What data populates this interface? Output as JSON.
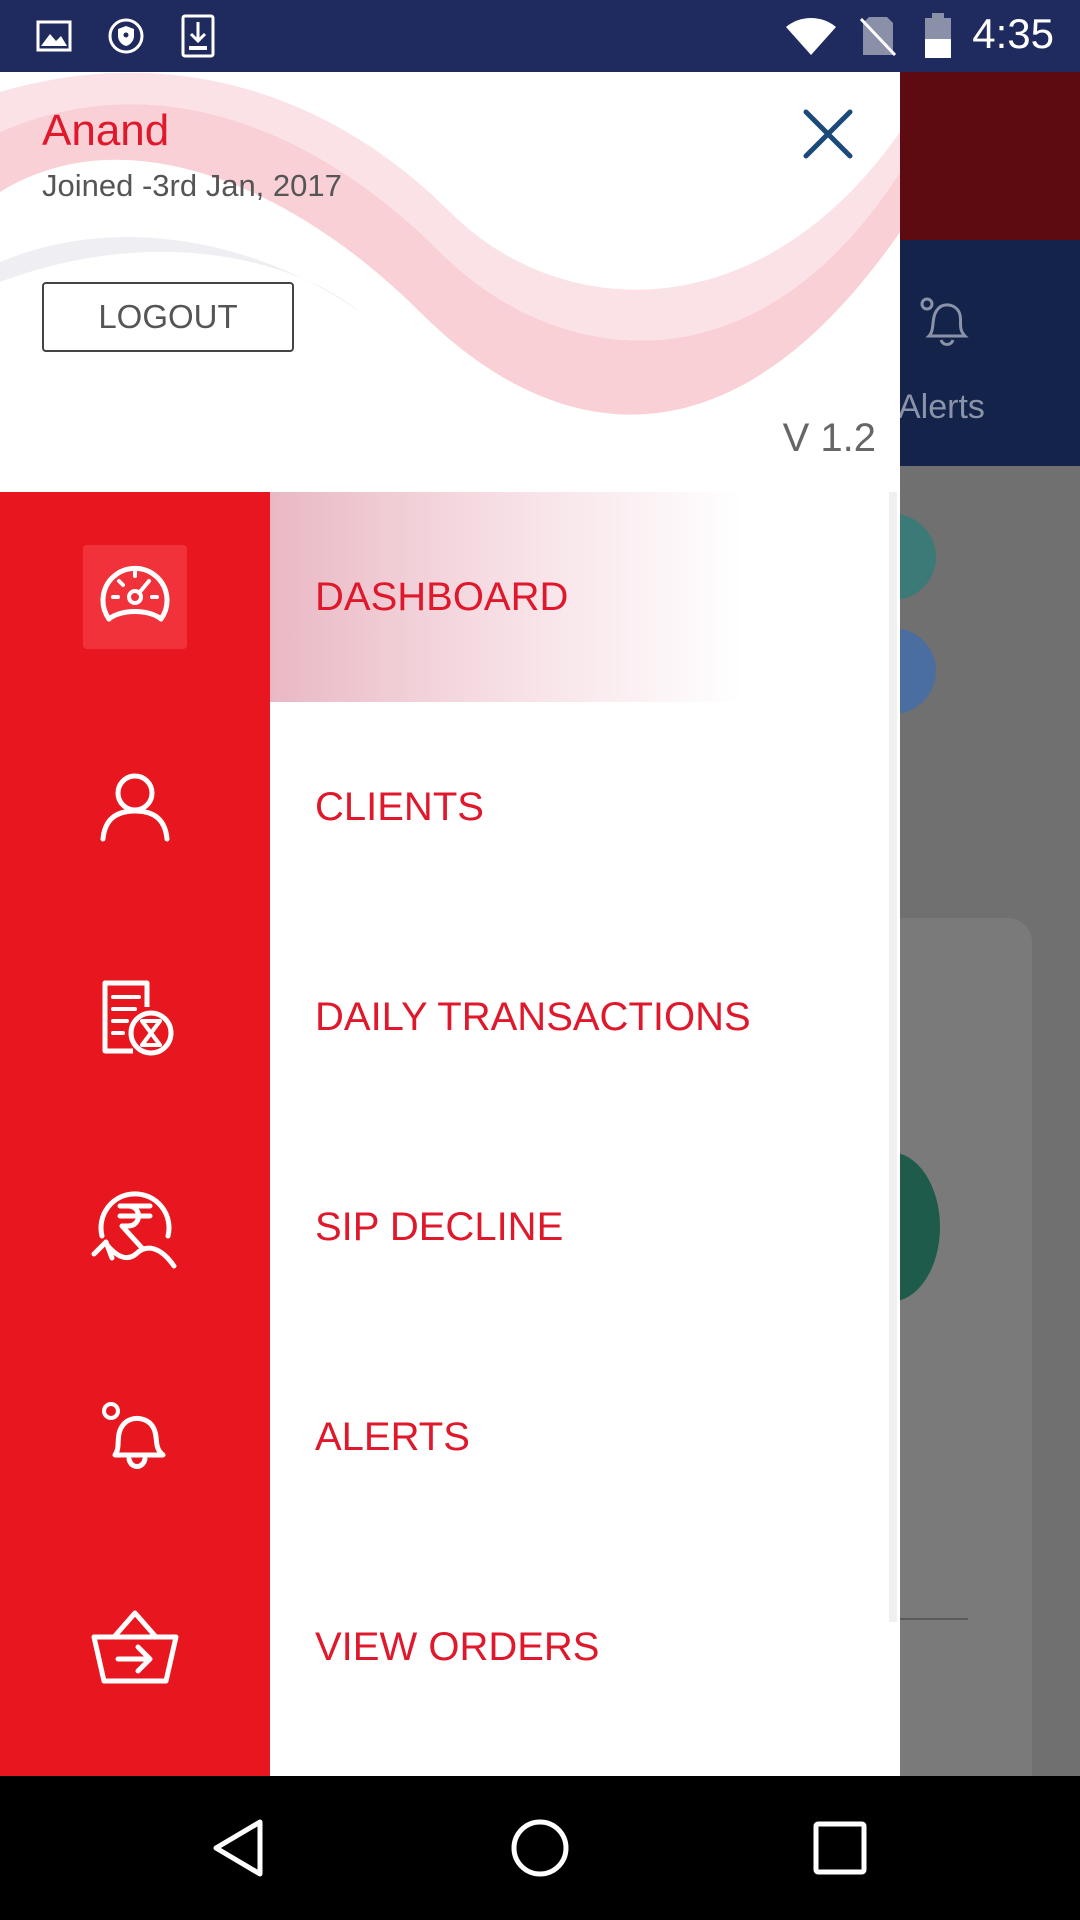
{
  "status_bar": {
    "time": "4:35",
    "icons": [
      "image-icon",
      "shield-icon",
      "download-icon",
      "wifi-icon",
      "no-sim-icon",
      "battery-icon"
    ]
  },
  "background_app": {
    "alerts_label": "Alerts"
  },
  "drawer": {
    "user_name": "Anand",
    "joined": "Joined -3rd Jan, 2017",
    "logout_label": "LOGOUT",
    "version": "V 1.2",
    "menu_items": [
      {
        "label": "DASHBOARD",
        "icon": "speedometer-icon",
        "active": true
      },
      {
        "label": "CLIENTS",
        "icon": "user-icon",
        "active": false
      },
      {
        "label": "DAILY TRANSACTIONS",
        "icon": "document-hourglass-icon",
        "active": false
      },
      {
        "label": "SIP DECLINE",
        "icon": "rupee-decline-icon",
        "active": false
      },
      {
        "label": "ALERTS",
        "icon": "bell-icon",
        "active": false
      },
      {
        "label": "VIEW ORDERS",
        "icon": "basket-icon",
        "active": false
      }
    ]
  },
  "colors": {
    "brand_red": "#e8171f",
    "label_red": "#e0182b",
    "status_bar": "#1f2b5e",
    "active_highlight": "#e9b8c4"
  },
  "nav_bar": {
    "buttons": [
      "back-icon",
      "home-icon",
      "recents-icon"
    ]
  }
}
